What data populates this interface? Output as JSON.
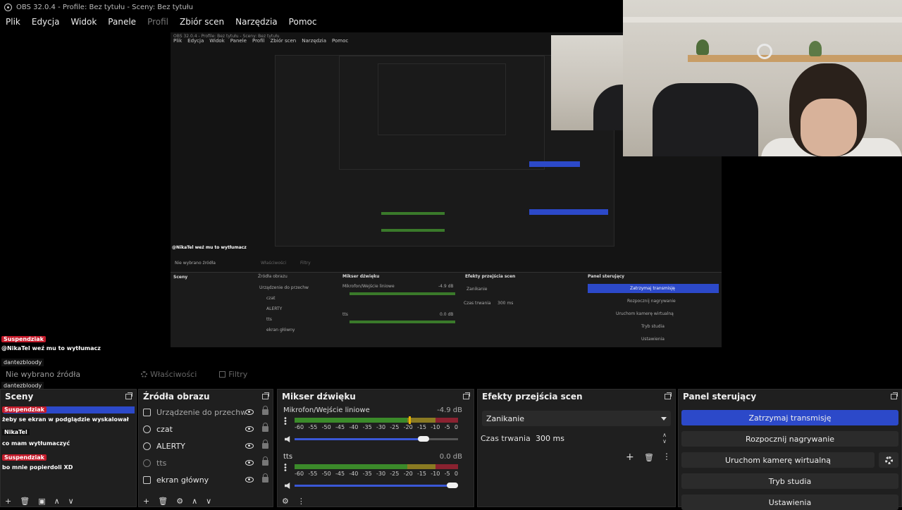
{
  "window": {
    "title": "OBS 32.0.4 - Profile: Bez tytułu - Sceny: Bez tytułu"
  },
  "menu": {
    "items": [
      "Plik",
      "Edycja",
      "Widok",
      "Panele",
      "Profil",
      "Zbiór scen",
      "Narzędzia",
      "Pomoc"
    ],
    "disabled": "Profil"
  },
  "preview": {
    "mini_title": "OBS 32.0.4 - Profile: Bez tytułu - Sceny: Bez tytułu",
    "mini_menu": [
      "Plik",
      "Edycja",
      "Widok",
      "Panele",
      "Profil",
      "Zbiór scen",
      "Narzędzia",
      "Pomoc"
    ],
    "mini_docks": [
      "Źródła obrazu",
      "Mikser dźwięku",
      "Efekty przejścia scen",
      "Panel sterujący"
    ],
    "mini_controls": [
      "Zatrzymaj transmisję",
      "Rozpocznij nagrywanie",
      "Uruchom kamerę wirtualną",
      "Tryb studia",
      "Ustawienia"
    ],
    "mini_sources": [
      "Urządzenie do przechw",
      "czat",
      "ALERTY",
      "tts",
      "ekran główny"
    ],
    "mini_mixer": {
      "mic": "Mikrofon/Wejście liniowe",
      "mic_db": "-4.9 dB",
      "tts": "tts",
      "tts_db": "0.0 dB"
    },
    "mini_transition": {
      "name": "Zanikanie",
      "duration_label": "Czas trwania",
      "duration": "300 ms"
    },
    "mini_chat": "@NikaTel weź mu to wytłumacz",
    "mini_no_source": "Nie wybrano źródła",
    "mini_props": "Właściwości",
    "mini_filters": "Filtry",
    "mini_scenes": "Sceny"
  },
  "chat": {
    "line1_user": "Suspendziak",
    "line1_msg": "@NikaTel weź mu to wytłumacz",
    "line2_user": "dantezbloody",
    "line3_user": "dantezbloody",
    "line4_user": "Suspendziak",
    "line4_msg": "żeby se ekran w podglądzie wyskalował",
    "line5_user": "NikaTel",
    "line5_msg": "co mam wytłumaczyć",
    "line6_user": "Suspendziak",
    "line6_msg": "bo mnie popierdoli XD"
  },
  "source_toolbar": {
    "no_source": "Nie wybrano źródła",
    "properties": "Właściwości",
    "filters": "Filtry"
  },
  "scenes": {
    "title": "Sceny"
  },
  "sources": {
    "title": "Źródła obrazu",
    "items": [
      {
        "label": "Urządzenie do przechw",
        "icon": "camera-icon"
      },
      {
        "label": "czat",
        "icon": "globe-icon"
      },
      {
        "label": "ALERTY",
        "icon": "globe-icon"
      },
      {
        "label": "tts",
        "icon": "globe-icon"
      },
      {
        "label": "ekran główny",
        "icon": "monitor-icon"
      }
    ]
  },
  "mixer": {
    "title": "Mikser dźwięku",
    "channels": [
      {
        "name": "Mikrofon/Wejście liniowe",
        "db": "-4.9 dB",
        "volume": 0.78
      },
      {
        "name": "tts",
        "db": "0.0 dB",
        "volume": 1.0
      }
    ],
    "ticks": [
      "-60",
      "-55",
      "-50",
      "-45",
      "-40",
      "-35",
      "-30",
      "-25",
      "-20",
      "-15",
      "-10",
      "-5",
      "0"
    ]
  },
  "transitions": {
    "title": "Efekty przejścia scen",
    "selected": "Zanikanie",
    "duration_label": "Czas trwania",
    "duration": "300 ms"
  },
  "controls": {
    "title": "Panel sterujący",
    "stop_stream": "Zatrzymaj transmisję",
    "start_record": "Rozpocznij nagrywanie",
    "virtual_cam": "Uruchom kamerę wirtualną",
    "studio_mode": "Tryb studia",
    "settings": "Ustawienia"
  },
  "colors": {
    "accent": "#2c49c9",
    "meter_green": "#3b8a2a",
    "meter_yellow": "#8a7a22",
    "meter_red": "#8a2230",
    "chat_tag": "#c41a2a"
  }
}
